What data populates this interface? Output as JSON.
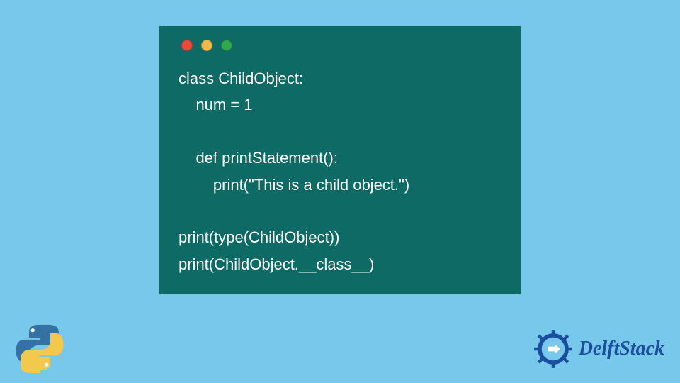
{
  "code": {
    "lines": [
      "class ChildObject:",
      "    num = 1",
      "",
      "    def printStatement():",
      "        print(\"This is a child object.\")",
      "",
      "print(type(ChildObject))",
      "print(ChildObject.__class__)"
    ]
  },
  "brand": {
    "name": "DelftStack"
  },
  "colors": {
    "bg": "#78c8eb",
    "panel": "#0d6a64",
    "code_text": "#ffffff",
    "brand_text": "#1a4fa0"
  }
}
